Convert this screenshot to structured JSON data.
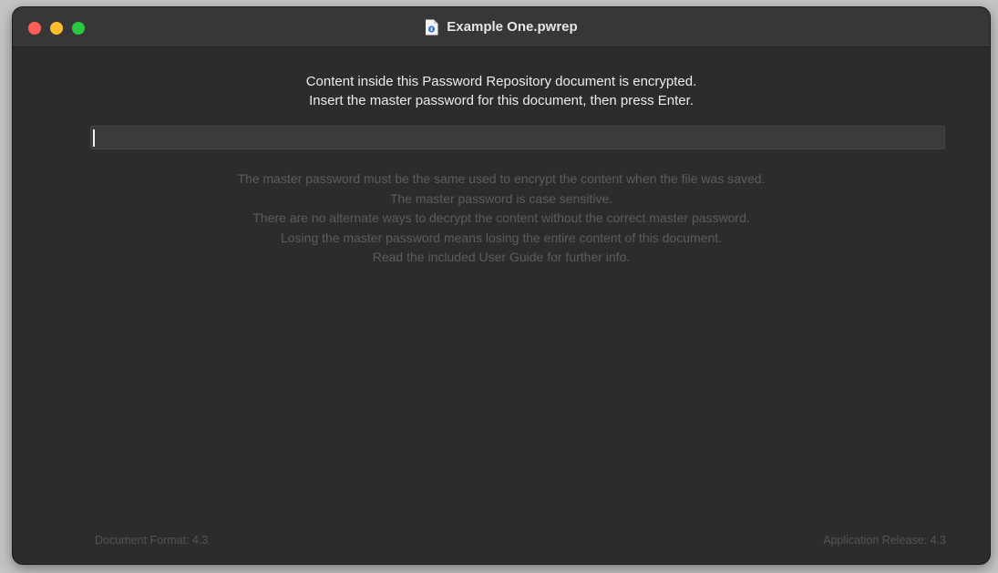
{
  "window": {
    "title": "Example One.pwrep",
    "title_icon": "document-icon"
  },
  "intro": {
    "line1": "Content inside this Password Repository document is encrypted.",
    "line2": "Insert the master password for this document, then press Enter."
  },
  "password_field": {
    "value": "",
    "placeholder": ""
  },
  "notes": {
    "line1": "The master password must be the same used to encrypt the content when the file was saved.",
    "line2": "The master password is case sensitive.",
    "line3": "There are no alternate ways to decrypt the content without the correct master password.",
    "line4": "Losing the master password means losing the entire content of this document.",
    "line5": "Read the included User Guide for further info."
  },
  "footer": {
    "document_format": "Document Format: 4.3",
    "application_release": "Application Release: 4.3"
  },
  "colors": {
    "close": "#ff5f57",
    "minimize": "#febc2e",
    "zoom": "#28c840",
    "background": "#2c2c2c",
    "titlebar": "#373737"
  }
}
